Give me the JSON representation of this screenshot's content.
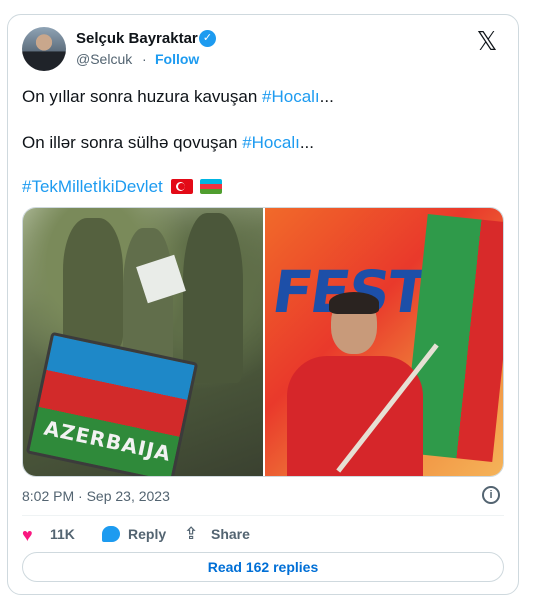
{
  "author": {
    "name": "Selçuk Bayraktar",
    "handle": "@Selcuk",
    "separator": "·",
    "follow_label": "Follow",
    "verified_glyph": "✓"
  },
  "platform_logo": "𝕏",
  "tweet": {
    "line1_text": "On yıllar sonra huzura kavuşan ",
    "line1_tag": "#Hocalı",
    "line1_suffix": "...",
    "line2_text": "On illər sonra sülhə qovuşan ",
    "line2_tag": "#Hocalı",
    "line2_suffix": "...",
    "line3_tag": "#TekMilletİkiDevlet",
    "flags": [
      "turkey-flag",
      "azerbaijan-flag"
    ]
  },
  "media": {
    "left_image": {
      "patch_text": "AZERBAIJA"
    },
    "right_image": {
      "sign_text": "FEST"
    }
  },
  "timestamp": "8:02 PM · Sep 23, 2023",
  "actions": {
    "likes": "11K",
    "reply_label": "Reply",
    "share_label": "Share"
  },
  "read_replies_label": "Read 162 replies",
  "colors": {
    "link": "#1d9bf0",
    "like": "#f91880",
    "text": "#0f1419",
    "muted": "#536471"
  }
}
